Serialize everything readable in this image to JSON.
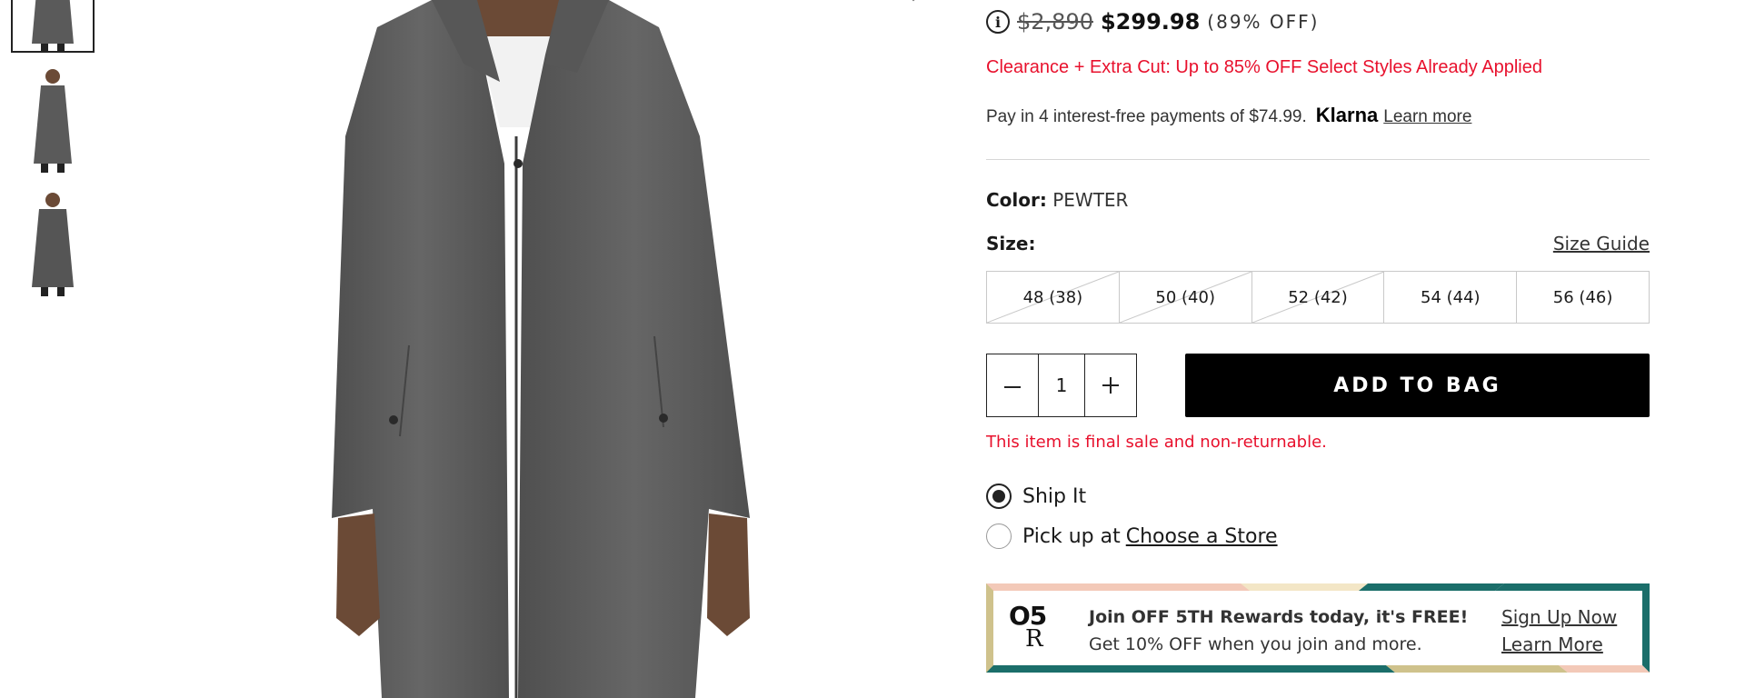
{
  "price": {
    "original": "$2,890",
    "sale": "$299.98",
    "discount": "(89% OFF)"
  },
  "promo_text": "Clearance + Extra Cut: Up to 85% OFF Select Styles Already Applied",
  "klarna": {
    "text": "Pay in 4 interest-free payments of $74.99.",
    "logo": "Klarna",
    "learn_more": "Learn more"
  },
  "color": {
    "label": "Color:",
    "value": "PEWTER"
  },
  "size": {
    "label": "Size:",
    "guide_label": "Size Guide",
    "options": [
      {
        "label": "48 (38)",
        "available": false
      },
      {
        "label": "50 (40)",
        "available": false
      },
      {
        "label": "52 (42)",
        "available": false
      },
      {
        "label": "54 (44)",
        "available": true
      },
      {
        "label": "56 (46)",
        "available": true
      }
    ]
  },
  "quantity": {
    "value": "1",
    "minus_icon": "minus-icon",
    "plus_icon": "plus-icon"
  },
  "add_to_bag": "ADD TO BAG",
  "final_sale": "This item is final sale and non-returnable.",
  "fulfillment": {
    "ship": {
      "label": "Ship It",
      "selected": true
    },
    "pickup": {
      "label": "Pick up at",
      "link": "Choose a Store",
      "selected": false
    }
  },
  "rewards": {
    "logo_top": "O5",
    "logo_bottom": "R",
    "title": "Join OFF 5TH Rewards today, it's FREE!",
    "subtitle": "Get 10% OFF when you join and more.",
    "sign_up": "Sign Up Now",
    "learn_more": "Learn More"
  },
  "colors": {
    "promo_red": "#e8112d",
    "button_black": "#000000",
    "coat_gray": "#5f5f5f",
    "teal": "#1b6e6a",
    "gold": "#cfc28c",
    "peach": "#f3c9b8"
  },
  "icons": {
    "info": "info-icon",
    "wishlist": "heart-icon"
  }
}
